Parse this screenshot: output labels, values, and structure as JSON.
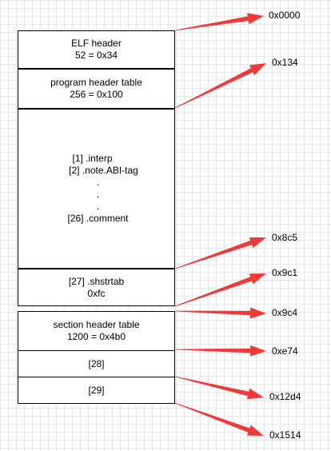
{
  "blocks": {
    "elf_header": {
      "title": "ELF header",
      "size": "52 = 0x34"
    },
    "program_header_table": {
      "title": "program header table",
      "size": "256 = 0x100"
    },
    "sections": {
      "line1": "[1] .interp",
      "line2": "[2] .note.ABI-tag",
      "dot1": ".",
      "dot2": ".",
      "dot3": ".",
      "line_last": "[26] .comment"
    },
    "shstrtab": {
      "title": "[27] .shstrtab",
      "size": "0xfc"
    },
    "section_header_table": {
      "title": "section header table",
      "size": "1200 = 0x4b0"
    },
    "sec28": "[28]",
    "sec29": "[29]"
  },
  "offsets": [
    "0x0000",
    "0x134",
    "0x8c5",
    "0x9c1",
    "0x9c4",
    "0xe74",
    "0x12d4",
    "0x1514"
  ],
  "colors": {
    "arrow": "#f03a3a",
    "border": "#000000"
  }
}
